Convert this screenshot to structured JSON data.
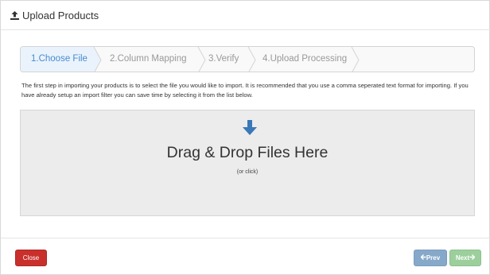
{
  "header": {
    "title": "Upload Products",
    "icon": "upload-icon"
  },
  "wizard": {
    "steps": [
      {
        "label": "1.Choose File",
        "active": true
      },
      {
        "label": "2.Column Mapping",
        "active": false
      },
      {
        "label": "3.Verify",
        "active": false
      },
      {
        "label": "4.Upload Processing",
        "active": false
      }
    ]
  },
  "intro": {
    "text": "The first step in importing your products is to select the file you would like to import. It is recommended that you use a comma seperated text format for importing. If you have already setup an import filter you can save time by selecting it from the list below."
  },
  "dropzone": {
    "icon": "arrow-down-icon",
    "title": "Drag & Drop Files Here",
    "subtitle": "(or click)"
  },
  "footer": {
    "close_label": "Close",
    "prev_label": "Prev",
    "next_label": "Next"
  },
  "colors": {
    "active_step": "#468bd1",
    "close_button": "#c9302c",
    "prev_button": "#87a9c9",
    "next_button": "#9ccf9c",
    "drop_arrow": "#3a78b8"
  }
}
